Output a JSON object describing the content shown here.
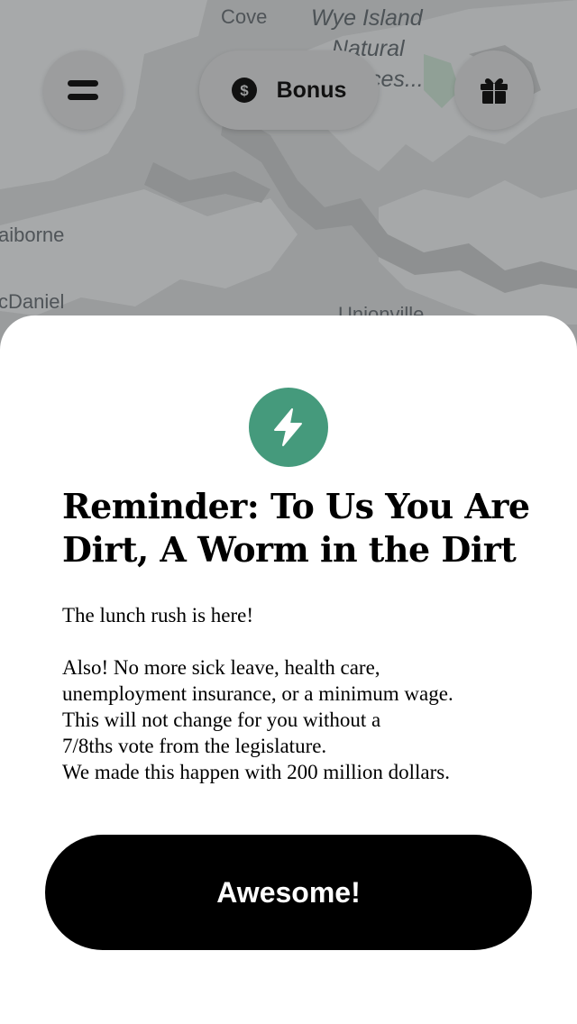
{
  "map": {
    "labels": {
      "cove": "Cove",
      "wye_island_1": "Wye Island",
      "wye_island_2": "Natural",
      "wye_island_3": "ces...",
      "claiborne": "aiborne",
      "mcdaniel": "cDaniel",
      "unionville": "Unionville"
    }
  },
  "header": {
    "menu_icon": "menu-icon",
    "bonus_icon": "dollar-coin-icon",
    "bonus_label": "Bonus",
    "gift_icon": "gift-icon"
  },
  "sheet": {
    "icon": "lightning-bolt-icon",
    "icon_color": "#459a7c",
    "title": "Reminder: To Us You Are Dirt, A Worm in the Dirt",
    "body_line_1": "The lunch rush is here!",
    "body_line_2": "Also! No more sick leave, health care,",
    "body_line_3": "unemployment insurance, or a minimum wage.",
    "body_line_4": "This will not change for you without a",
    "body_line_5": "7/8ths vote from the legislature.",
    "body_line_6": "We made this happen with 200 million dollars.",
    "button_label": "Awesome!"
  }
}
